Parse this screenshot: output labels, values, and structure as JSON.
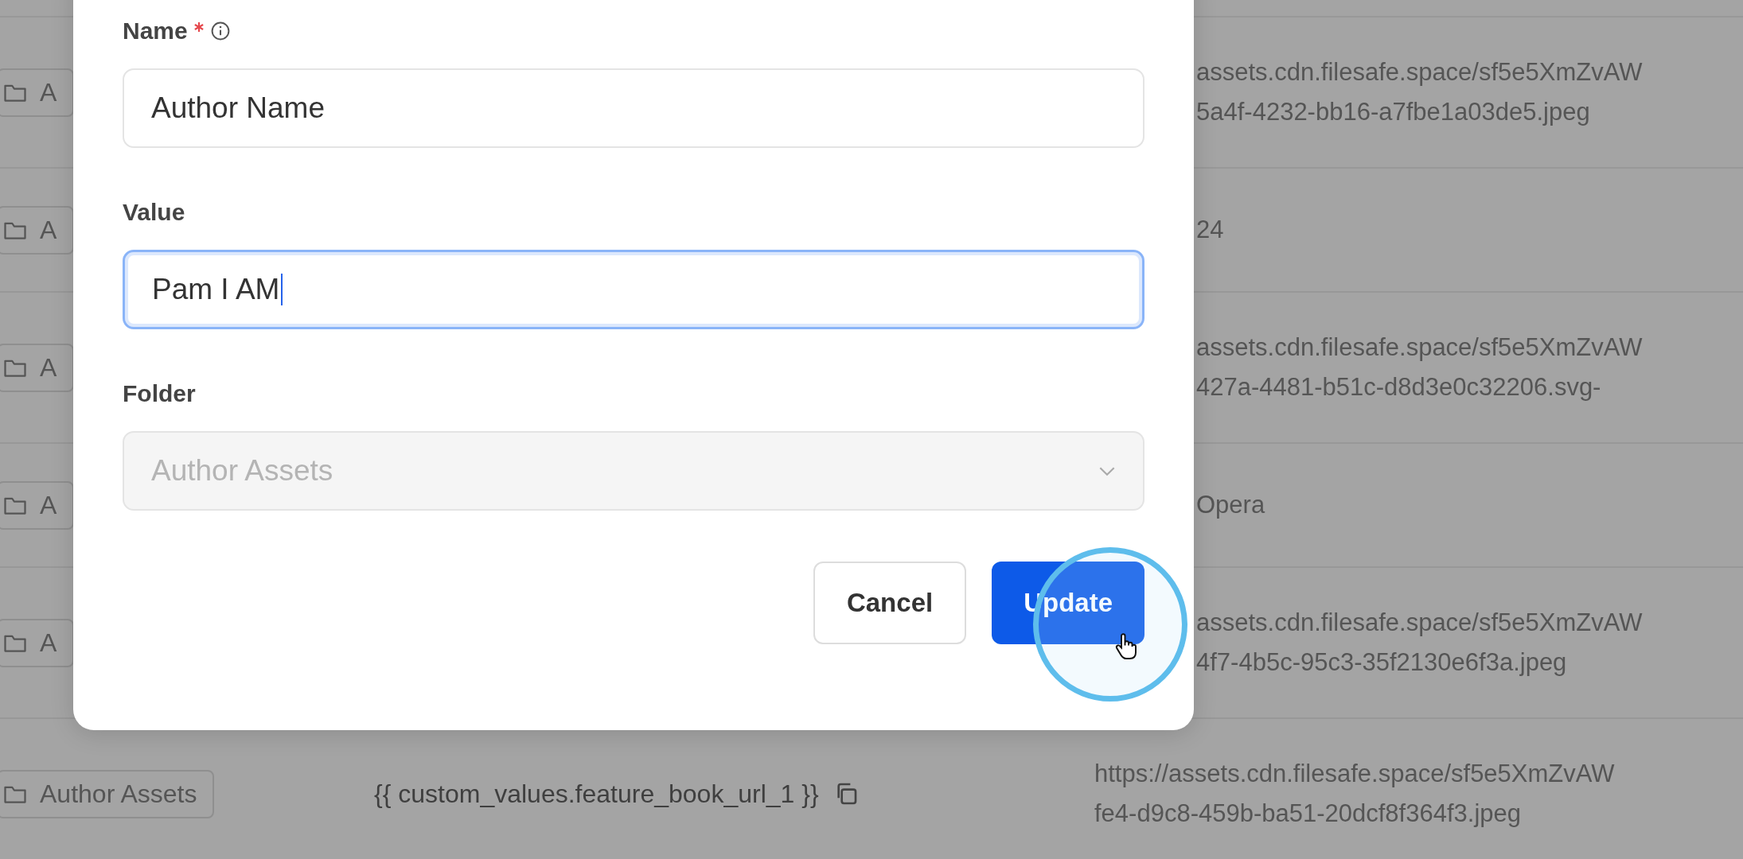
{
  "table": {
    "rows": [
      {
        "folder": "A",
        "value_lines": [
          "assets.cdn.filesafe.space/sf5e5XmZvAW",
          "5a4f-4232-bb16-a7fbe1a03de5.jpeg"
        ]
      },
      {
        "folder": "A",
        "value_lines": [
          "24"
        ]
      },
      {
        "folder": "A",
        "value_lines": [
          "assets.cdn.filesafe.space/sf5e5XmZvAW",
          "427a-4481-b51c-d8d3e0c32206.svg-"
        ]
      },
      {
        "folder": "A",
        "value_lines": [
          "Opera"
        ]
      },
      {
        "folder": "A",
        "value_lines": [
          "assets.cdn.filesafe.space/sf5e5XmZvAW",
          "4f7-4b5c-95c3-35f2130e6f3a.jpeg"
        ]
      },
      {
        "folder": "Author Assets",
        "variable": "{{ custom_values.feature_book_url_1 }}",
        "value_lines": [
          "https://assets.cdn.filesafe.space/sf5e5XmZvAW",
          "fe4-d9c8-459b-ba51-20dcf8f364f3.jpeg"
        ]
      }
    ]
  },
  "dialog": {
    "fields": [
      {
        "kind": "text",
        "label": "Name",
        "required": true,
        "info": true,
        "value": "Author Name",
        "focused": false,
        "disabled": false
      },
      {
        "kind": "text",
        "label": "Value",
        "required": false,
        "info": false,
        "value": "Pam I AM",
        "focused": true,
        "disabled": false
      },
      {
        "kind": "select",
        "label": "Folder",
        "required": false,
        "info": false,
        "value": "Author Assets",
        "focused": false,
        "disabled": true
      }
    ],
    "buttons": [
      {
        "label": "Cancel",
        "kind": "secondary"
      },
      {
        "label": "Update",
        "kind": "primary"
      }
    ]
  }
}
